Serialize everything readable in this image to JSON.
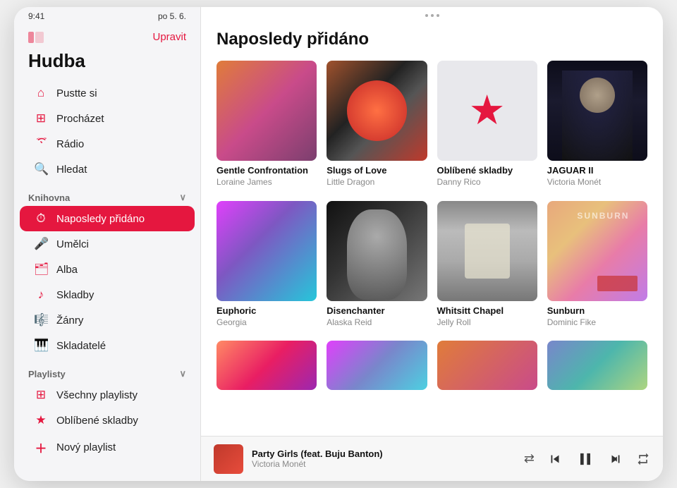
{
  "device": {
    "status_bar": {
      "time": "9:41",
      "date": "po 5. 6."
    }
  },
  "sidebar": {
    "title": "Hudba",
    "upravit_label": "Upravit",
    "nav_items": [
      {
        "id": "pustte-si",
        "label": "Pustte si",
        "icon": "🏠"
      },
      {
        "id": "prochazet",
        "label": "Procházet",
        "icon": "⊞"
      },
      {
        "id": "radio",
        "label": "Rádio",
        "icon": "📶"
      },
      {
        "id": "hledat",
        "label": "Hledat",
        "icon": "🔍"
      }
    ],
    "section_knihovna": "Knihovna",
    "knihovna_items": [
      {
        "id": "naposledy-pridano",
        "label": "Naposledy přidáno",
        "icon": "⏱",
        "active": true
      },
      {
        "id": "umelci",
        "label": "Umělci",
        "icon": "🎤"
      },
      {
        "id": "alba",
        "label": "Alba",
        "icon": "🗂"
      },
      {
        "id": "skladby",
        "label": "Skladby",
        "icon": "🎵"
      },
      {
        "id": "zanry",
        "label": "Žánry",
        "icon": "🎼"
      },
      {
        "id": "skladatele",
        "label": "Skladatelé",
        "icon": "🎹"
      }
    ],
    "section_playlisty": "Playlisty",
    "playlisty_items": [
      {
        "id": "vsechny-playlisty",
        "label": "Všechny playlisty",
        "icon": "⊞"
      },
      {
        "id": "oblibene-skladby",
        "label": "Oblíbené skladby",
        "icon": "⭐"
      },
      {
        "id": "novy-playlist",
        "label": "Nový playlist",
        "icon": "+"
      }
    ]
  },
  "main": {
    "section_title": "Naposledy přidáno",
    "albums": [
      {
        "id": 1,
        "name": "Gentle Confrontation",
        "artist": "Loraine James",
        "art_class": "art-1"
      },
      {
        "id": 2,
        "name": "Slugs of Love",
        "artist": "Little Dragon",
        "art_class": "art-2"
      },
      {
        "id": 3,
        "name": "Oblíbené skladby",
        "artist": "Danny Rico",
        "art_class": "art-3"
      },
      {
        "id": 4,
        "name": "JAGUAR II",
        "artist": "Victoria Monét",
        "art_class": "art-4"
      },
      {
        "id": 5,
        "name": "Euphoric",
        "artist": "Georgia",
        "art_class": "art-5"
      },
      {
        "id": 6,
        "name": "Disenchanter",
        "artist": "Alaska Reid",
        "art_class": "art-6"
      },
      {
        "id": 7,
        "name": "Whitsitt Chapel",
        "artist": "Jelly Roll",
        "art_class": "art-7"
      },
      {
        "id": 8,
        "name": "Sunburn",
        "artist": "Dominic Fike",
        "art_class": "art-8"
      },
      {
        "id": 9,
        "name": "",
        "artist": "",
        "art_class": "art-9"
      },
      {
        "id": 10,
        "name": "",
        "artist": "",
        "art_class": "art-10"
      },
      {
        "id": 11,
        "name": "",
        "artist": "",
        "art_class": "art-1"
      },
      {
        "id": 12,
        "name": "",
        "artist": "",
        "art_class": "art-2"
      }
    ]
  },
  "now_playing": {
    "title": "Party Girls (feat. Buju Banton)",
    "artist": "Victoria Monét",
    "art_class": "art-np"
  },
  "controls": {
    "shuffle": "⇄",
    "prev": "⏮",
    "play": "⏸",
    "next": "⏭",
    "repeat": "↻"
  }
}
